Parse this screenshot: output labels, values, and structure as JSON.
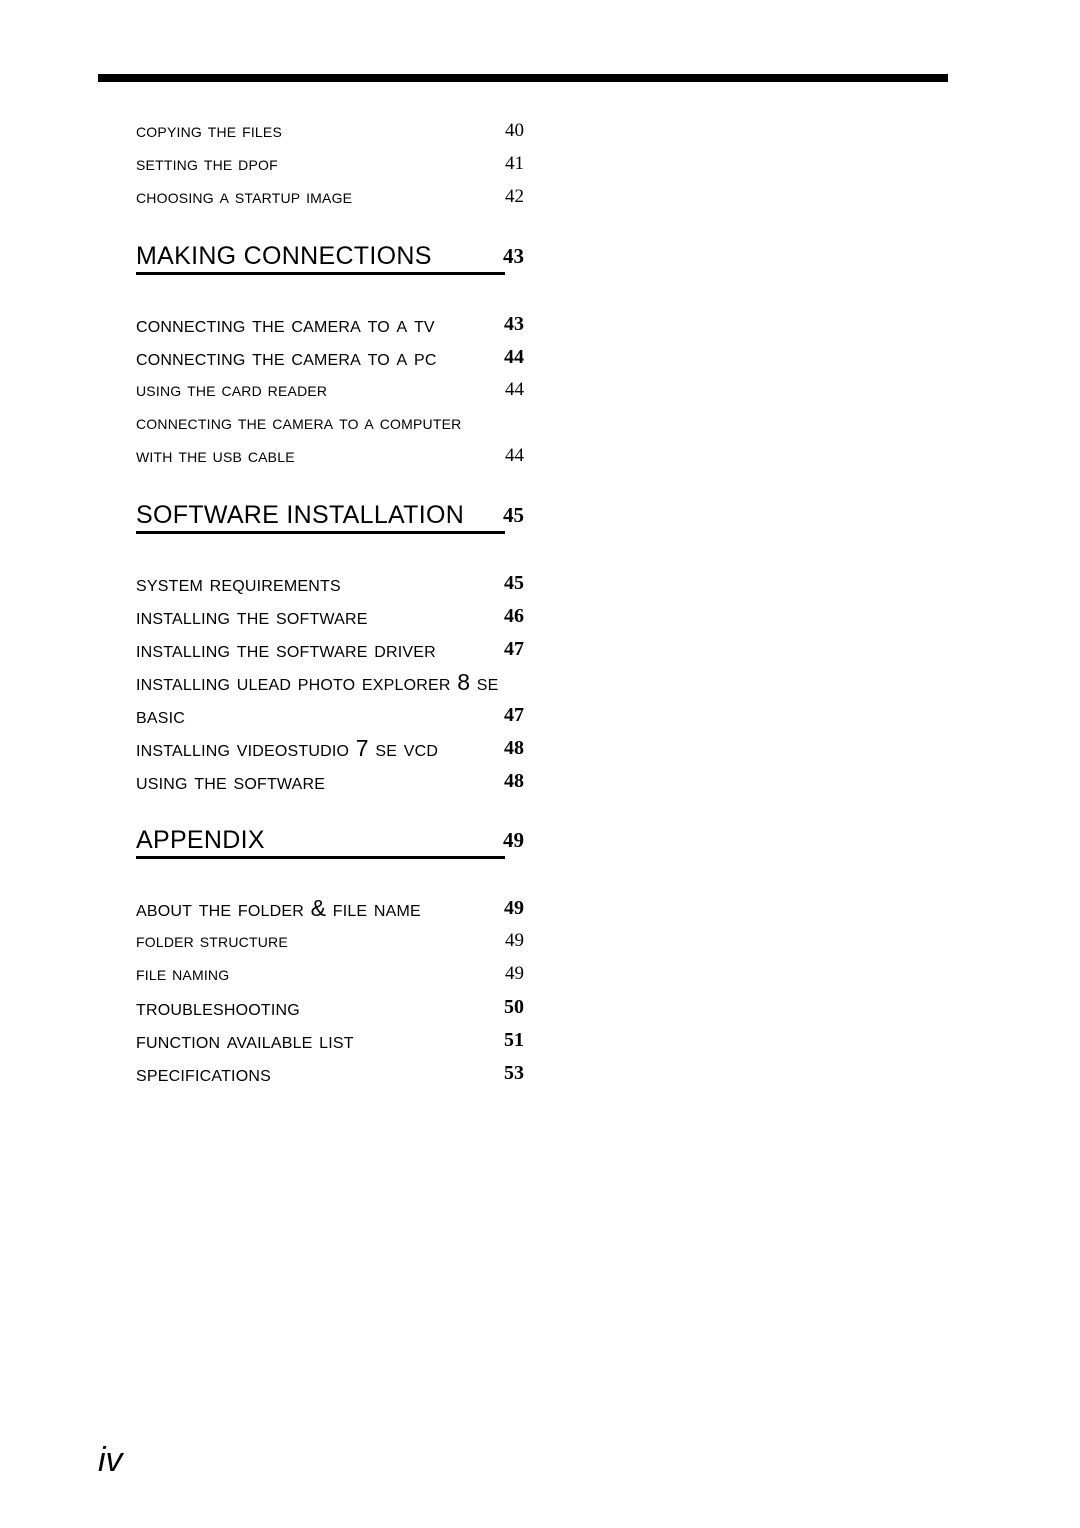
{
  "document": {
    "folio": "iv",
    "top_rule": true
  },
  "toc": {
    "entries": [
      {
        "level": 3,
        "label": "Copying the Files",
        "page": "40"
      },
      {
        "level": 3,
        "label": "Setting the DPOF",
        "page": "41"
      },
      {
        "level": 3,
        "label": "Choosing a Startup Image",
        "page": "42"
      },
      {
        "level": 1,
        "label": "Making Connections",
        "page": "43"
      },
      {
        "level": 2,
        "label": "Connecting the Camera to a TV",
        "page": "43"
      },
      {
        "level": 2,
        "label": "Connecting the Camera to a PC",
        "page": "44"
      },
      {
        "level": 3,
        "label": "Using the Card Reader",
        "page": "44"
      },
      {
        "level": 3,
        "label": "Connecting the Camera to a Computer",
        "page": ""
      },
      {
        "level": 3,
        "label": "with the USB Cable",
        "page": "44"
      },
      {
        "level": 1,
        "label": "Software Installation",
        "page": "45"
      },
      {
        "level": 2,
        "label": "System Requirements",
        "page": "45"
      },
      {
        "level": 2,
        "label": "Installing the Software",
        "page": "46"
      },
      {
        "level": 2,
        "label": "Installing the Software Driver",
        "page": "47"
      },
      {
        "level": 2,
        "label": "Installing Ulead Photo Explorer 8 SE",
        "page": ""
      },
      {
        "level": 2,
        "label": "Basic",
        "page": "47"
      },
      {
        "level": 2,
        "label": "Installing VideoStudio 7 SE VCD",
        "page": "48"
      },
      {
        "level": 2,
        "label": "Using the Software",
        "page": "48"
      },
      {
        "level": 1,
        "label": "Appendix",
        "page": "49"
      },
      {
        "level": 2,
        "label": "About the Folder & File Name",
        "page": "49"
      },
      {
        "level": 3,
        "label": "Folder Structure",
        "page": "49"
      },
      {
        "level": 3,
        "label": "File Naming",
        "page": "49"
      },
      {
        "level": 2,
        "label": "Troubleshooting",
        "page": "50"
      },
      {
        "level": 2,
        "label": "Function Available List",
        "page": "51"
      },
      {
        "level": 2,
        "label": "Specifications",
        "page": "53"
      }
    ]
  }
}
